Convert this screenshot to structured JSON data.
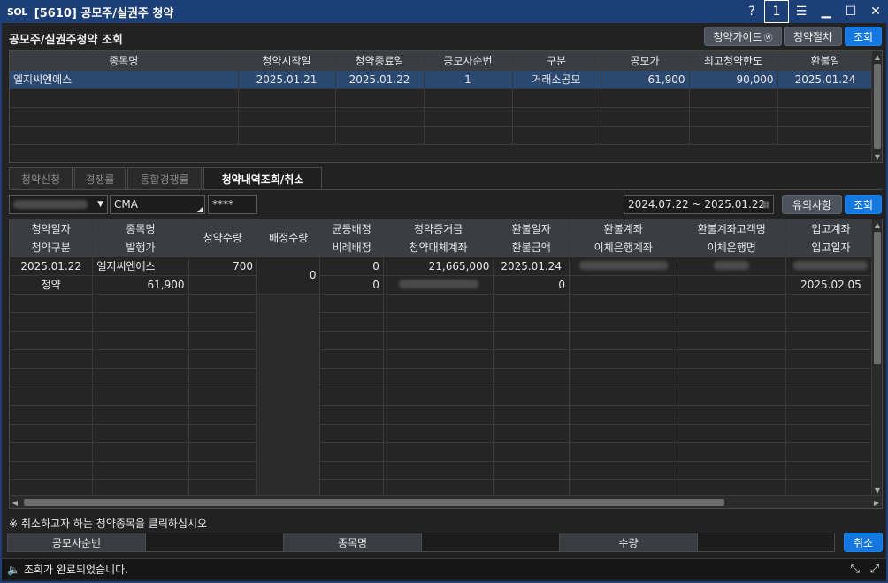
{
  "window": {
    "logo": "SOL",
    "title": "[5610] 공모주/실권주 청약",
    "help": "?",
    "one": "1"
  },
  "top": {
    "section_title": "공모주/실권주청약 조회",
    "guide_btn": "청약가이드",
    "process_btn": "청약절차",
    "query_btn": "조회",
    "columns": [
      "종목명",
      "청약시작일",
      "청약종료일",
      "공모사순번",
      "구분",
      "공모가",
      "최고청약한도",
      "환불일"
    ],
    "rows": [
      [
        "엘지씨엔에스",
        "2025.01.21",
        "2025.01.22",
        "1",
        "거래소공모",
        "61,900",
        "90,000",
        "2025.01.24"
      ]
    ]
  },
  "tabs": [
    "청약신청",
    "경쟁률",
    "통합경쟁률",
    "청약내역조회/취소"
  ],
  "filter": {
    "account_type": "CMA",
    "password": "****",
    "date_range": "2024.07.22 ~ 2025.01.22",
    "notice_btn": "유의사항",
    "query_btn": "조회"
  },
  "detail": {
    "header_top": [
      "청약일자",
      "종목명",
      "청약수량",
      "배정수량",
      "균등배정",
      "청약증거금",
      "환불일자",
      "환불계좌",
      "환불계좌고객명",
      "입고계좌"
    ],
    "header_bottom": [
      "청약구분",
      "발행가",
      "",
      "",
      "비례배정",
      "청약대체계좌",
      "환불금액",
      "이체은행계좌",
      "이체은행명",
      "입고일자"
    ],
    "row1": [
      "2025.01.22",
      "엘지씨엔에스",
      "700",
      "0",
      "0",
      "21,665,000",
      "2025.01.24"
    ],
    "row2": [
      "청약",
      "61,900",
      "",
      "",
      "0",
      "",
      "0",
      "",
      "",
      "2025.02.05"
    ]
  },
  "note": "※ 취소하고자 하는 청약종목을 클릭하십시오",
  "bottom": {
    "labels": [
      "공모사순번",
      "종목명",
      "수량"
    ],
    "cancel_btn": "취소"
  },
  "status": {
    "message": "조회가 완료되었습니다."
  }
}
